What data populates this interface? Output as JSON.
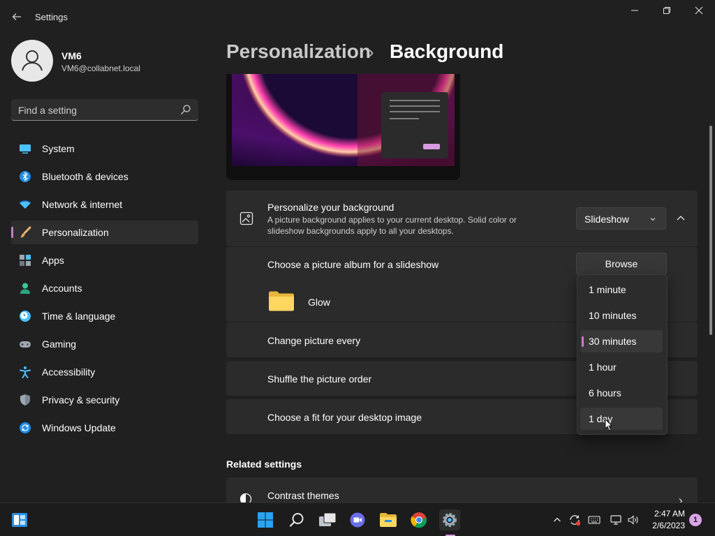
{
  "window": {
    "title": "Settings",
    "back_icon": "back-arrow-icon",
    "controls": [
      "minimize-icon",
      "restore-icon",
      "close-icon"
    ]
  },
  "user": {
    "name": "VM6",
    "email": "VM6@collabnet.local"
  },
  "search": {
    "placeholder": "Find a setting",
    "value": ""
  },
  "sidebar": {
    "items": [
      {
        "label": "System",
        "icon": "monitor-icon"
      },
      {
        "label": "Bluetooth & devices",
        "icon": "bluetooth-icon"
      },
      {
        "label": "Network & internet",
        "icon": "wifi-icon"
      },
      {
        "label": "Personalization",
        "icon": "brush-icon",
        "active": true
      },
      {
        "label": "Apps",
        "icon": "apps-icon"
      },
      {
        "label": "Accounts",
        "icon": "person-icon"
      },
      {
        "label": "Time & language",
        "icon": "clock-globe-icon"
      },
      {
        "label": "Gaming",
        "icon": "gamepad-icon"
      },
      {
        "label": "Accessibility",
        "icon": "accessibility-icon"
      },
      {
        "label": "Privacy & security",
        "icon": "shield-icon"
      },
      {
        "label": "Windows Update",
        "icon": "update-icon"
      }
    ]
  },
  "breadcrumb": {
    "parent": "Personalization",
    "separator": "›",
    "current": "Background"
  },
  "background": {
    "title": "Personalize your background",
    "description_line1": "A picture background applies to your current desktop. Solid color or",
    "description_line2": "slideshow backgrounds apply to all your desktops.",
    "type_value": "Slideshow",
    "album_label": "Choose a picture album for a slideshow",
    "browse_label": "Browse",
    "album_name": "Glow",
    "change_every_label": "Change picture every",
    "shuffle_label": "Shuffle the picture order",
    "fit_label": "Choose a fit for your desktop image"
  },
  "interval_dropdown": {
    "options": [
      "1 minute",
      "10 minutes",
      "30 minutes",
      "1 hour",
      "6 hours",
      "1 day"
    ],
    "selected": "30 minutes",
    "hovered": "1 day"
  },
  "related": {
    "title": "Related settings",
    "contrast_themes": "Contrast themes"
  },
  "taskbar": {
    "apps": [
      "windows-start-icon",
      "search-icon",
      "task-view-icon",
      "teams-chat-icon",
      "file-explorer-icon",
      "chrome-icon",
      "settings-icon"
    ],
    "active_app": "settings-icon",
    "tray": [
      "chevron-up-icon",
      "sync-icon",
      "keyboard-icon",
      "network-icon",
      "volume-icon"
    ],
    "time": "2:47 AM",
    "date": "2/6/2023",
    "notification_count": "1"
  },
  "colors": {
    "accent": "#c77dc9",
    "background": "#202020",
    "card": "#2b2b2b"
  }
}
